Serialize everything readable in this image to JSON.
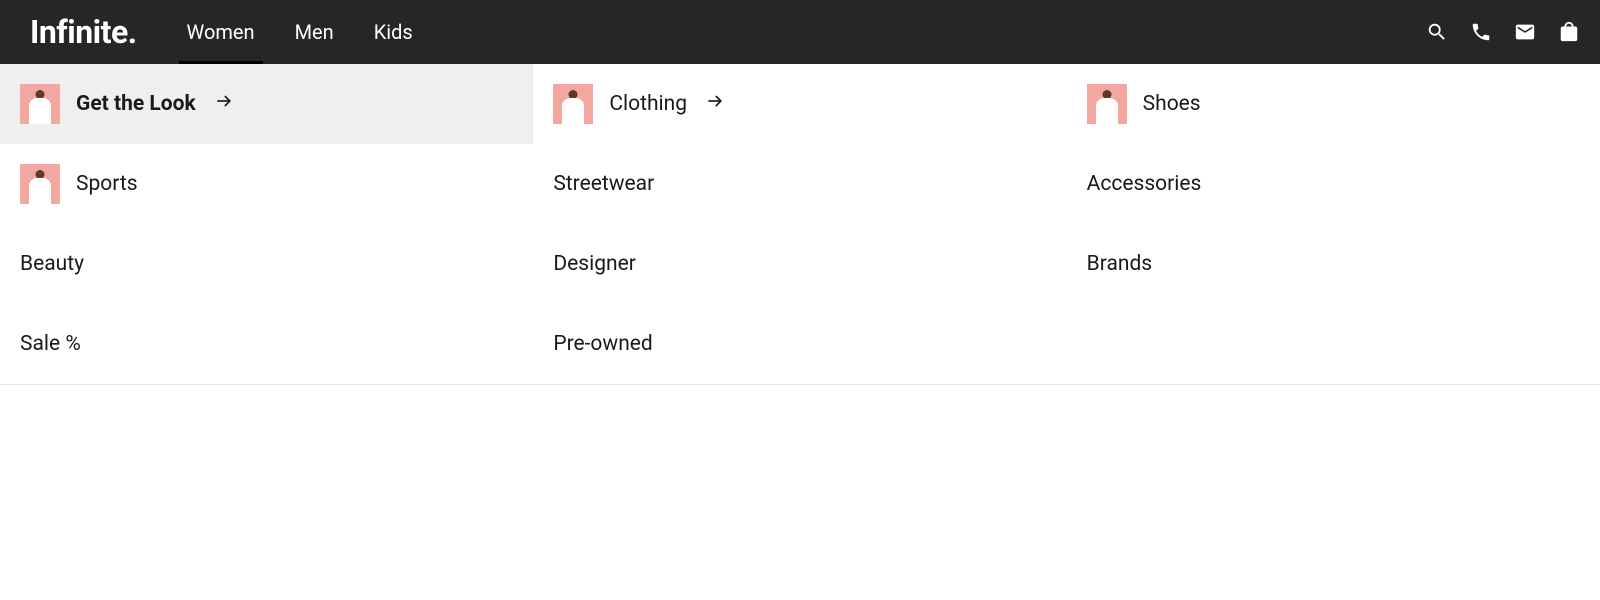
{
  "header": {
    "logo": "Infinite.",
    "tabs": [
      {
        "label": "Women",
        "active": true
      },
      {
        "label": "Men",
        "active": false
      },
      {
        "label": "Kids",
        "active": false
      }
    ]
  },
  "menu": {
    "columns": [
      [
        {
          "label": "Get the Look",
          "thumb": true,
          "arrow": true,
          "selected": true
        },
        {
          "label": "Sports",
          "thumb": true,
          "arrow": false,
          "selected": false
        },
        {
          "label": "Beauty",
          "thumb": false,
          "arrow": false,
          "selected": false
        },
        {
          "label": "Sale %",
          "thumb": false,
          "arrow": false,
          "selected": false
        }
      ],
      [
        {
          "label": "Clothing",
          "thumb": true,
          "arrow": true,
          "selected": false
        },
        {
          "label": "Streetwear",
          "thumb": false,
          "arrow": false,
          "selected": false
        },
        {
          "label": "Designer",
          "thumb": false,
          "arrow": false,
          "selected": false
        },
        {
          "label": "Pre-owned",
          "thumb": false,
          "arrow": false,
          "selected": false
        }
      ],
      [
        {
          "label": "Shoes",
          "thumb": true,
          "arrow": false,
          "selected": false
        },
        {
          "label": "Accessories",
          "thumb": false,
          "arrow": false,
          "selected": false
        },
        {
          "label": "Brands",
          "thumb": false,
          "arrow": false,
          "selected": false
        }
      ]
    ]
  }
}
